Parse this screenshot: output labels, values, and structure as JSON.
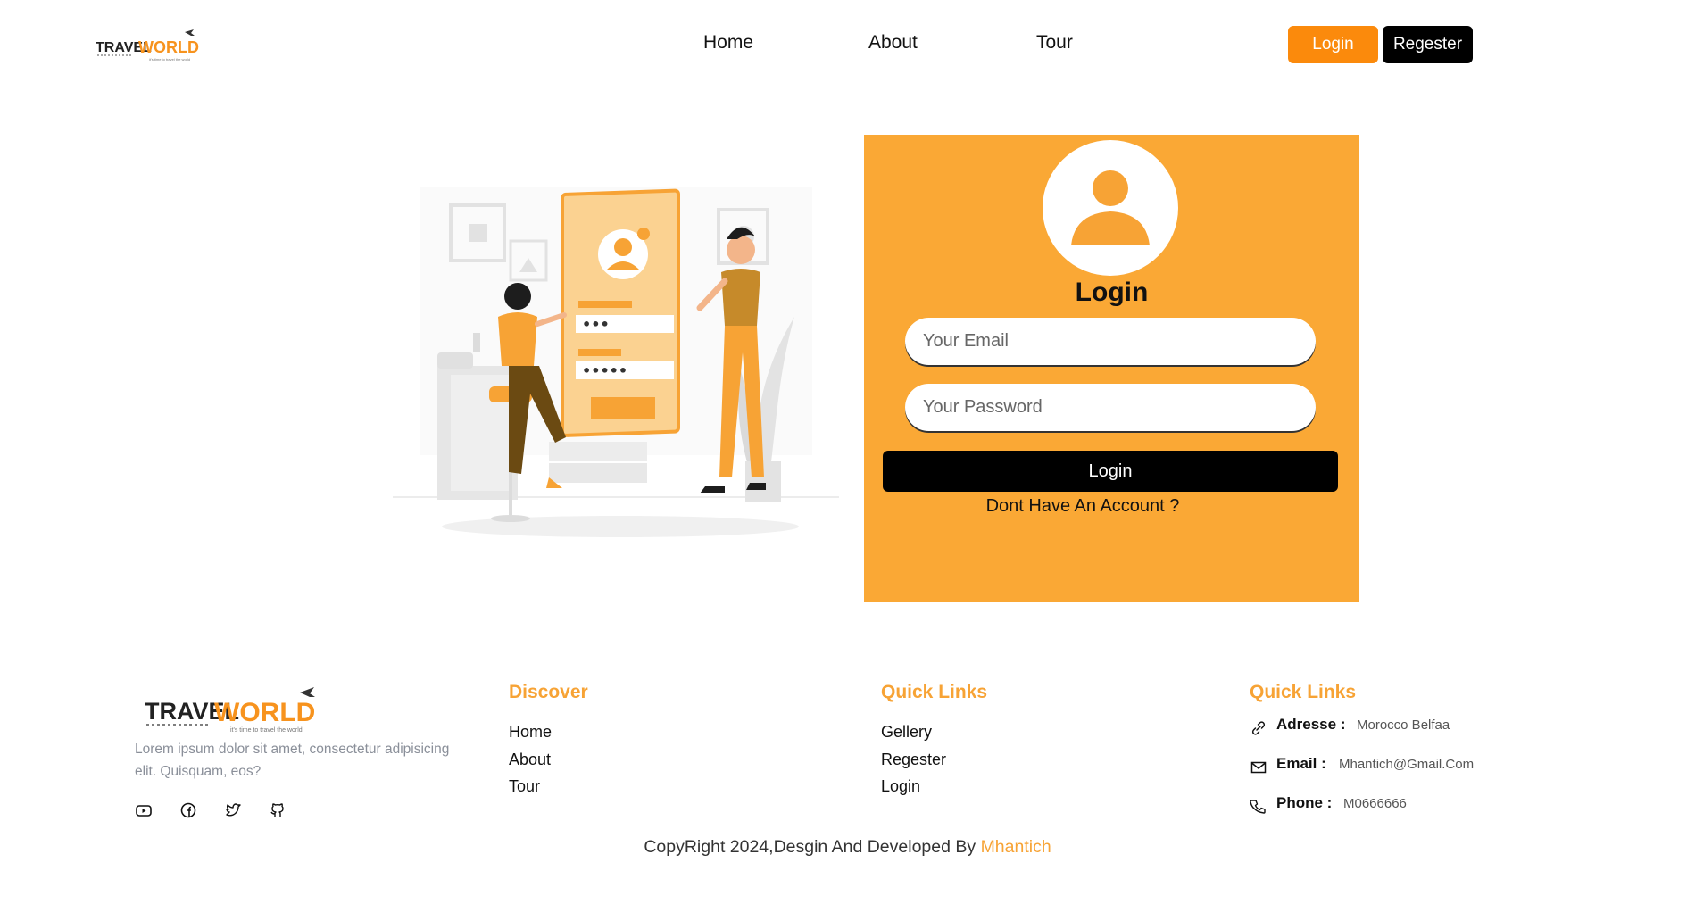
{
  "brand": {
    "name_part1": "TRAVEL",
    "name_part2": "WORLD",
    "tagline": "it's time to travel the world"
  },
  "nav": {
    "items": [
      "Home",
      "About",
      "Tour"
    ],
    "login_label": "Login",
    "register_label": "Regester"
  },
  "login_form": {
    "title": "Login",
    "email_placeholder": "Your Email",
    "password_placeholder": "Your Password",
    "submit_label": "Login",
    "no_account_text": "Dont Have An Account ?"
  },
  "footer": {
    "description": "Lorem ipsum dolor sit amet, consectetur adipisicing elit. Quisquam, eos?",
    "socials": [
      "youtube-icon",
      "facebook-icon",
      "twitter-icon",
      "github-icon"
    ],
    "discover": {
      "title": "Discover",
      "items": [
        "Home",
        "About",
        "Tour"
      ]
    },
    "quick_links": {
      "title": "Quick Links",
      "items": [
        "Gellery",
        "Regester",
        "Login"
      ]
    },
    "contact": {
      "title": "Quick Links",
      "address_label": "Adresse :",
      "address_value": "Morocco Belfaa",
      "email_label": "Email :",
      "email_value": "Mhantich@Gmail.Com",
      "phone_label": "Phone :",
      "phone_value": "M0666666"
    },
    "copyright_text": "CopyRight 2024,Desgin And Developed By",
    "copyright_author": "Mhantich"
  },
  "colors": {
    "accent": "#faa835",
    "button_orange": "#fb8a0c",
    "black": "#000000"
  }
}
